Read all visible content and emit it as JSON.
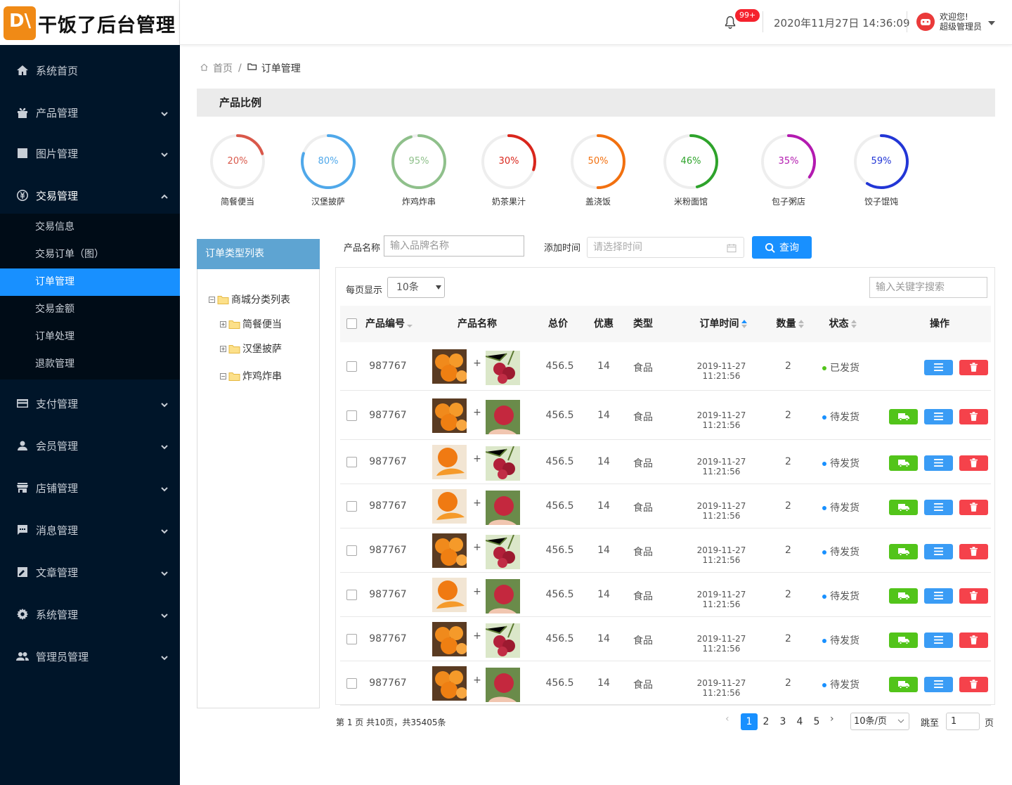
{
  "app": {
    "logo_mark": "D\\",
    "title": "干饭了后台管理"
  },
  "header": {
    "notif_count": "99+",
    "datetime": "2020年11月27日 14:36:09",
    "welcome": "欢迎您!",
    "role": "超级管理员"
  },
  "sidebar": {
    "items": [
      {
        "label": "系统首页",
        "icon": "home-icon"
      },
      {
        "label": "产品管理",
        "icon": "gift-icon"
      },
      {
        "label": "图片管理",
        "icon": "image-icon"
      },
      {
        "label": "交易管理",
        "icon": "yen-icon"
      },
      {
        "label": "支付管理",
        "icon": "card-icon"
      },
      {
        "label": "会员管理",
        "icon": "person-icon"
      },
      {
        "label": "店铺管理",
        "icon": "store-icon"
      },
      {
        "label": "消息管理",
        "icon": "message-icon"
      },
      {
        "label": "文章管理",
        "icon": "article-icon"
      },
      {
        "label": "系统管理",
        "icon": "gear-icon"
      },
      {
        "label": "管理员管理",
        "icon": "group-icon"
      }
    ],
    "sub": [
      "交易信息",
      "交易订单（图）",
      "订单管理",
      "交易金额",
      "订单处理",
      "退款管理"
    ]
  },
  "breadcrumb": {
    "home": "首页",
    "sep": "/",
    "current": "订单管理"
  },
  "ratio": {
    "title": "产品比例",
    "items": [
      {
        "label": "简餐便当",
        "value": 20,
        "pct": "20%",
        "color": "#d9584a"
      },
      {
        "label": "汉堡披萨",
        "value": 80,
        "pct": "80%",
        "color": "#4fa8ea"
      },
      {
        "label": "炸鸡炸串",
        "value": 95,
        "pct": "95%",
        "color": "#8fc08b"
      },
      {
        "label": "奶茶果汁",
        "value": 30,
        "pct": "30%",
        "color": "#d9261c"
      },
      {
        "label": "盖浇饭",
        "value": 50,
        "pct": "50%",
        "color": "#f2700f"
      },
      {
        "label": "米粉面馆",
        "value": 46,
        "pct": "46%",
        "color": "#2ea32b"
      },
      {
        "label": "包子粥店",
        "value": 35,
        "pct": "35%",
        "color": "#b31ab0"
      },
      {
        "label": "饺子馄饨",
        "value": 59,
        "pct": "59%",
        "color": "#2236d6"
      }
    ]
  },
  "tree": {
    "title": "订单类型列表",
    "root": "商城分类列表",
    "children": [
      "简餐便当",
      "汉堡披萨",
      "炸鸡炸串"
    ]
  },
  "filters": {
    "name_label": "产品名称",
    "name_placeholder": "输入品牌名称",
    "time_label": "添加时间",
    "time_placeholder": "请选择时间",
    "query": "查询"
  },
  "table": {
    "page_size_label": "每页显示",
    "page_size": "10条",
    "search_placeholder": "输入关键字搜索",
    "headers": {
      "id": "产品编号",
      "name": "产品名称",
      "total": "总价",
      "discount": "优惠",
      "type": "类型",
      "time": "订单时间",
      "qty": "数量",
      "status": "状态",
      "ops": "操作"
    },
    "plus": "+",
    "rows": [
      {
        "id": "987767",
        "total": "456.5",
        "discount": "14",
        "type": "食品",
        "time": "2019-11-27 11:21:56",
        "qty": "2",
        "status": "已发货",
        "status_color": "#52c41a",
        "ship": false
      },
      {
        "id": "987767",
        "total": "456.5",
        "discount": "14",
        "type": "食品",
        "time": "2019-11-27 11:21:56",
        "qty": "2",
        "status": "待发货",
        "status_color": "#1890ff",
        "ship": true
      },
      {
        "id": "987767",
        "total": "456.5",
        "discount": "14",
        "type": "食品",
        "time": "2019-11-27 11:21:56",
        "qty": "2",
        "status": "待发货",
        "status_color": "#1890ff",
        "ship": true
      },
      {
        "id": "987767",
        "total": "456.5",
        "discount": "14",
        "type": "食品",
        "time": "2019-11-27 11:21:56",
        "qty": "2",
        "status": "待发货",
        "status_color": "#1890ff",
        "ship": true
      },
      {
        "id": "987767",
        "total": "456.5",
        "discount": "14",
        "type": "食品",
        "time": "2019-11-27 11:21:56",
        "qty": "2",
        "status": "待发货",
        "status_color": "#1890ff",
        "ship": true
      },
      {
        "id": "987767",
        "total": "456.5",
        "discount": "14",
        "type": "食品",
        "time": "2019-11-27 11:21:56",
        "qty": "2",
        "status": "待发货",
        "status_color": "#1890ff",
        "ship": true
      },
      {
        "id": "987767",
        "total": "456.5",
        "discount": "14",
        "type": "食品",
        "time": "2019-11-27 11:21:56",
        "qty": "2",
        "status": "待发货",
        "status_color": "#1890ff",
        "ship": true
      },
      {
        "id": "987767",
        "total": "456.5",
        "discount": "14",
        "type": "食品",
        "time": "2019-11-27 11:21:56",
        "qty": "2",
        "status": "待发货",
        "status_color": "#1890ff",
        "ship": true
      }
    ]
  },
  "pagination": {
    "summary": "第 1 页 共10页，共35405条",
    "pages": [
      "1",
      "2",
      "3",
      "4",
      "5"
    ],
    "current": "1",
    "per_page": "10条/页",
    "jump_label": "跳至",
    "jump_value": "1",
    "page_unit": "页"
  },
  "colors": {
    "sidebar": "#001529",
    "active": "#1890ff",
    "ship_btn": "#52c41a",
    "detail_btn": "#3a9cf5",
    "delete_btn": "#f5424b"
  }
}
